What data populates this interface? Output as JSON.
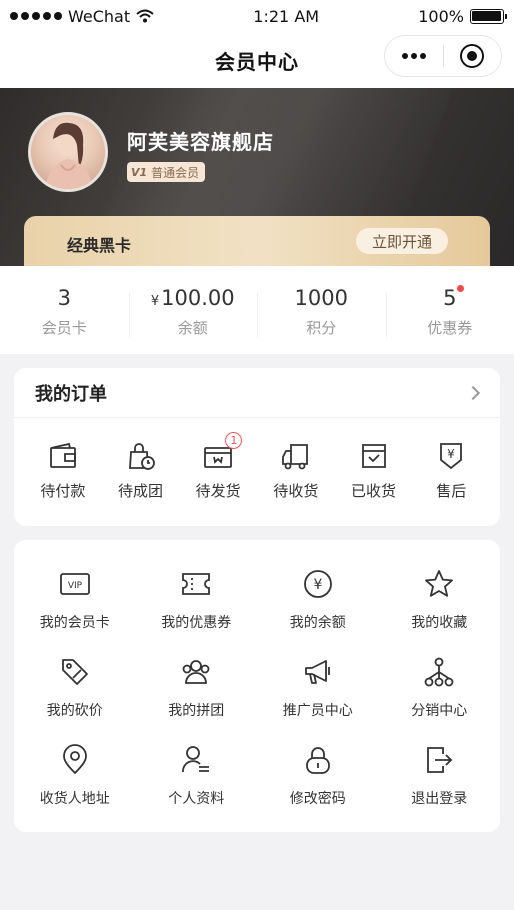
{
  "status_bar": {
    "carrier": "WeChat",
    "time": "1:21 AM",
    "battery": "100%"
  },
  "nav": {
    "title": "会员中心"
  },
  "header": {
    "store_name": "阿芙美容旗舰店",
    "member_level": "普通会员",
    "badge_mark": "V1"
  },
  "black_card": {
    "title": "经典黑卡",
    "action": "立即开通"
  },
  "stats": [
    {
      "value": "3",
      "label": "会员卡"
    },
    {
      "currency": "¥",
      "value": "100.00",
      "label": "余额"
    },
    {
      "value": "1000",
      "label": "积分"
    },
    {
      "value": "5",
      "label": "优惠券"
    }
  ],
  "orders": {
    "title": "我的订单",
    "items": [
      {
        "label": "待付款",
        "icon": "wallet-icon"
      },
      {
        "label": "待成团",
        "icon": "shopping-bag-clock-icon"
      },
      {
        "label": "待发货",
        "icon": "box-icon",
        "badge": "1"
      },
      {
        "label": "待收货",
        "icon": "truck-icon"
      },
      {
        "label": "已收货",
        "icon": "box-check-icon"
      },
      {
        "label": "售后",
        "icon": "refund-icon",
        "glyph": "¥"
      }
    ]
  },
  "services": {
    "items": [
      {
        "label": "我的会员卡",
        "icon": "vip-card-icon",
        "glyph": "VIP"
      },
      {
        "label": "我的优惠券",
        "icon": "ticket-icon"
      },
      {
        "label": "我的余额",
        "icon": "balance-icon",
        "glyph": "¥"
      },
      {
        "label": "我的收藏",
        "icon": "star-icon"
      },
      {
        "label": "我的砍价",
        "icon": "discount-tag-icon"
      },
      {
        "label": "我的拼团",
        "icon": "group-icon"
      },
      {
        "label": "推广员中心",
        "icon": "megaphone-icon"
      },
      {
        "label": "分销中心",
        "icon": "network-icon"
      },
      {
        "label": "收货人地址",
        "icon": "location-icon"
      },
      {
        "label": "个人资料",
        "icon": "profile-icon"
      },
      {
        "label": "修改密码",
        "icon": "lock-icon"
      },
      {
        "label": "退出登录",
        "icon": "logout-icon"
      }
    ]
  }
}
